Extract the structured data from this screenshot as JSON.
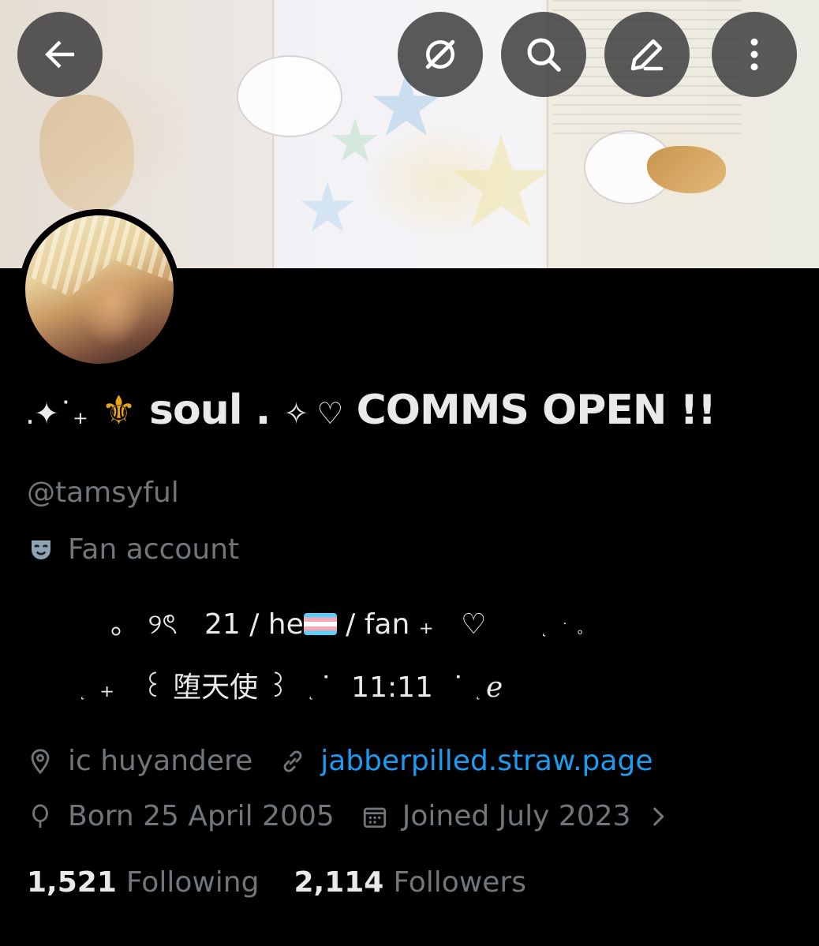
{
  "header": {
    "buttons": [
      {
        "icon": "back-arrow-icon"
      },
      {
        "icon": "grok-icon"
      },
      {
        "icon": "search-icon"
      },
      {
        "icon": "edit-pencil-icon"
      },
      {
        "icon": "more-vertical-icon"
      }
    ]
  },
  "profile": {
    "display_name_prefix": ".✦˙₊",
    "display_name_fleur": "⚜",
    "display_name_main": " soul . ",
    "display_name_sym": "✧ ♡",
    "display_name_suffix": " COMMS OPEN !!",
    "handle": "@tamsyful",
    "category_label": "Fan account",
    "bio_line1_a": "。 ୨ৎ   21 / he",
    "bio_line1_b": " / fan ₊   ♡",
    "bio_line1_dots": "˛   ˙  。",
    "bio_line2_a": "₊   ꒰ 堕天使 ꒱",
    "bio_line2_b": "˙  11:11  ˙",
    "bio_line2_c": "ℯ",
    "location": "ic huyandere",
    "website": "jabberpilled.straw.page",
    "birthday": "Born 25 April 2005",
    "joined": "Joined July 2023",
    "following_count": "1,521",
    "following_label": "Following",
    "followers_count": "2,114",
    "followers_label": "Followers"
  },
  "colors": {
    "background": "#000000",
    "text_primary": "#e7e9ea",
    "text_secondary": "#71767b",
    "link": "#1d9bf0",
    "fleur": "#e6a417"
  }
}
